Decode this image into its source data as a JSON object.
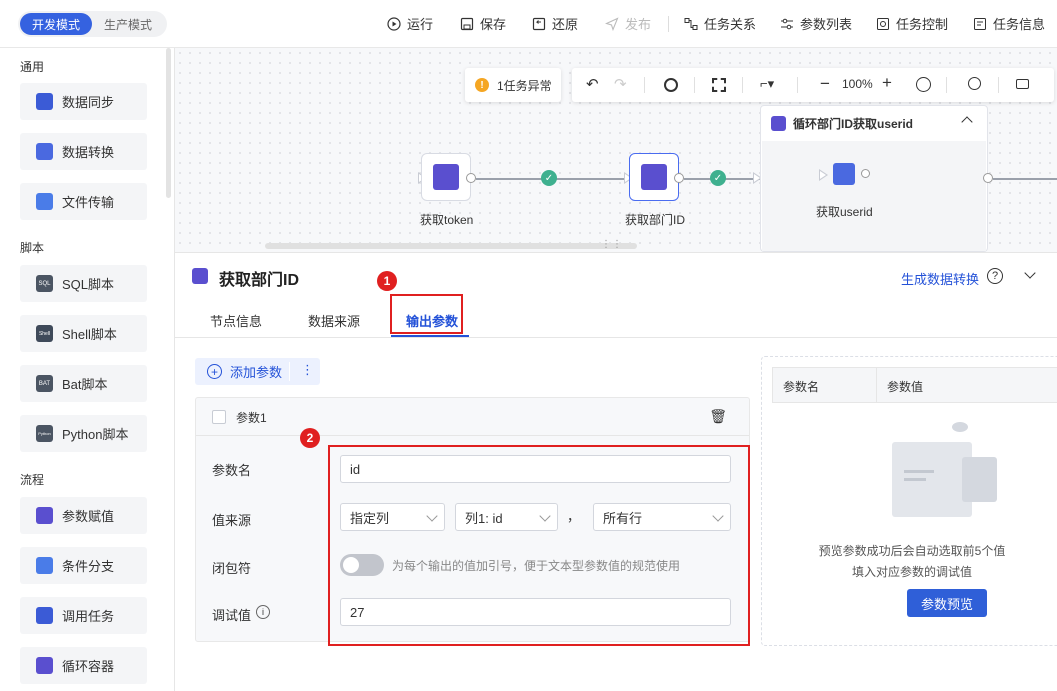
{
  "topbar": {
    "mode_dev": "开发模式",
    "mode_prod": "生产模式",
    "run": "运行",
    "save": "保存",
    "restore": "还原",
    "publish": "发布",
    "task_relation": "任务关系",
    "param_list": "参数列表",
    "task_control": "任务控制",
    "task_info": "任务信息"
  },
  "sidebar": {
    "sections": [
      {
        "title": "通用",
        "items": [
          "数据同步",
          "数据转换",
          "文件传输"
        ]
      },
      {
        "title": "脚本",
        "items": [
          "SQL脚本",
          "Shell脚本",
          "Bat脚本",
          "Python脚本"
        ]
      },
      {
        "title": "流程",
        "items": [
          "参数赋值",
          "条件分支",
          "调用任务",
          "循环容器"
        ]
      }
    ],
    "icons": {
      "sql": "SQL",
      "shell": "Shell",
      "bat": "BAT",
      "python": "Python"
    }
  },
  "canvas": {
    "alert": "1任务异常",
    "zoom": "100%",
    "nodes": [
      {
        "label": "获取token"
      },
      {
        "label": "获取部门ID"
      },
      {
        "label": "获取userid"
      }
    ],
    "loop_title": "循环部门ID获取userid"
  },
  "panel": {
    "title": "获取部门ID",
    "gen_link": "生成数据转换",
    "tabs": [
      "节点信息",
      "数据来源",
      "输出参数"
    ],
    "add_param": "添加参数",
    "param": {
      "name_checkbox": "参数1",
      "name_label": "参数名",
      "name_value": "id",
      "source_label": "值来源",
      "source_type": "指定列",
      "source_column": "列1: id",
      "comma": "，",
      "source_rows": "所有行",
      "closure_label": "闭包符",
      "closure_hint": "为每个输出的值加引号，便于文本型参数值的规范使用",
      "debug_label": "调试值",
      "debug_value": "27"
    },
    "preview": {
      "col_name": "参数名",
      "col_value": "参数值",
      "hint_line1": "预览参数成功后会自动选取前5个值",
      "hint_line2": "填入对应参数的调试值",
      "button": "参数预览"
    },
    "badges": [
      "1",
      "2"
    ]
  },
  "colors": {
    "primary": "#2452d8",
    "annotation": "#e02020",
    "success": "#3fb08f"
  }
}
